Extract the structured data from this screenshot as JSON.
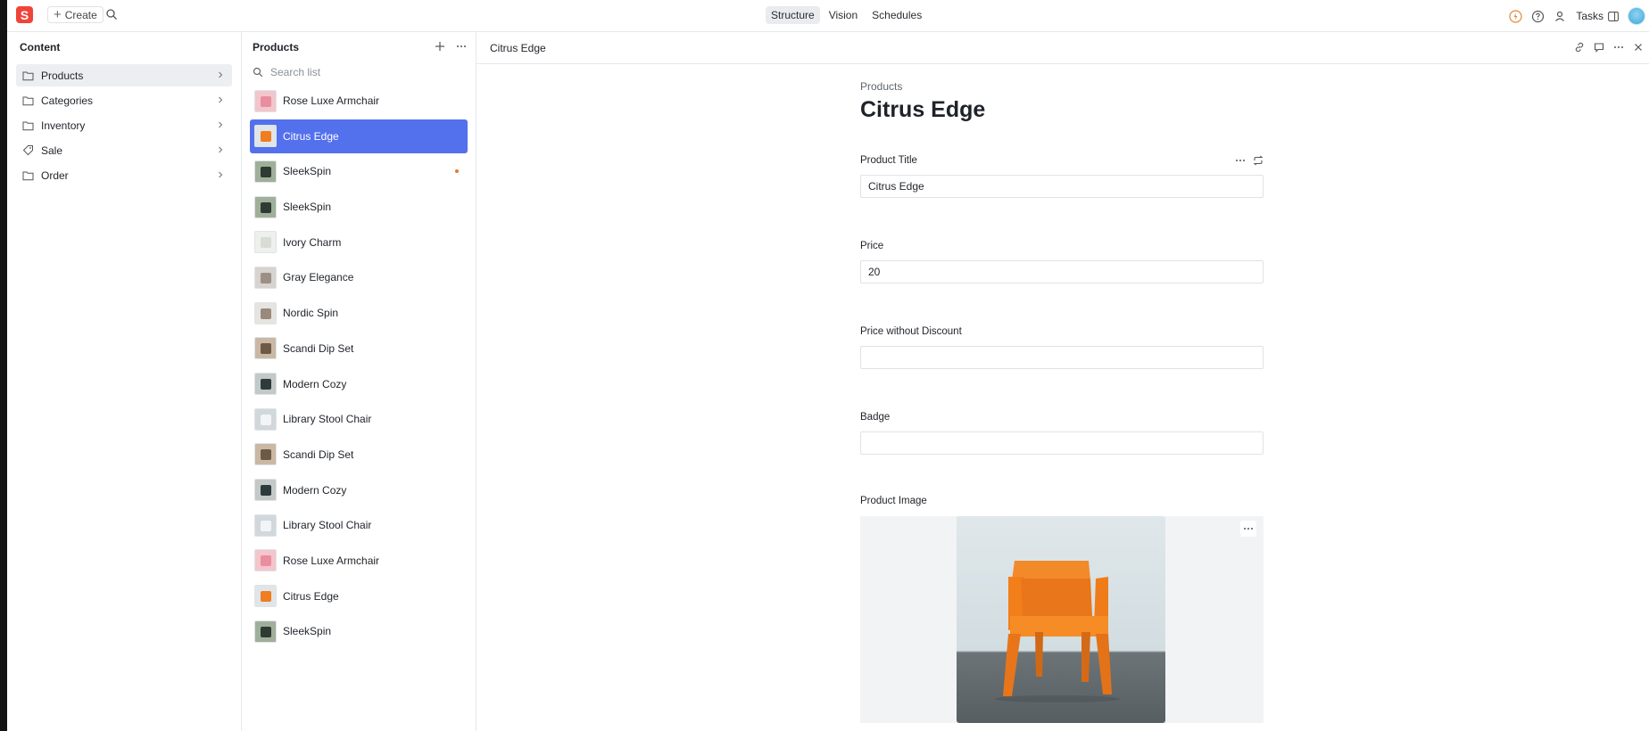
{
  "topbar": {
    "logo_letter": "S",
    "create_label": "Create",
    "tabs": [
      {
        "label": "Structure",
        "active": true
      },
      {
        "label": "Vision",
        "active": false
      },
      {
        "label": "Schedules",
        "active": false
      }
    ],
    "tasks_label": "Tasks"
  },
  "content_pane": {
    "title": "Content",
    "items": [
      {
        "label": "Products",
        "icon": "folder-icon",
        "active": true
      },
      {
        "label": "Categories",
        "icon": "folder-icon",
        "active": false
      },
      {
        "label": "Inventory",
        "icon": "folder-icon",
        "active": false
      },
      {
        "label": "Sale",
        "icon": "tag-icon",
        "active": false
      },
      {
        "label": "Order",
        "icon": "folder-icon",
        "active": false
      }
    ]
  },
  "products_pane": {
    "title": "Products",
    "search_placeholder": "Search list",
    "items": [
      {
        "label": "Rose Luxe Armchair",
        "thumb": "#f3c5cc",
        "chair": "#e98ea0"
      },
      {
        "label": "Citrus Edge",
        "thumb": "#dfe5e8",
        "chair": "#f07d1f",
        "selected": true
      },
      {
        "label": "SleekSpin",
        "thumb": "#9fb09a",
        "chair": "#2f3a33",
        "dot": true
      },
      {
        "label": "SleekSpin",
        "thumb": "#9fb09a",
        "chair": "#2f3a33"
      },
      {
        "label": "Ivory Charm",
        "thumb": "#eef0ee",
        "chair": "#d9dcd4"
      },
      {
        "label": "Gray Elegance",
        "thumb": "#d7d3cf",
        "chair": "#9b8f88"
      },
      {
        "label": "Nordic Spin",
        "thumb": "#e6e4e1",
        "chair": "#9a8a7b"
      },
      {
        "label": "Scandi Dip Set",
        "thumb": "#c9b9a4",
        "chair": "#6e5946"
      },
      {
        "label": "Modern Cozy",
        "thumb": "#c3c9c6",
        "chair": "#2e3b3c"
      },
      {
        "label": "Library Stool Chair",
        "thumb": "#d0d8dc",
        "chair": "#f2f4f5"
      },
      {
        "label": "Scandi Dip Set",
        "thumb": "#c9b9a4",
        "chair": "#6e5946"
      },
      {
        "label": "Modern Cozy",
        "thumb": "#c3c9c6",
        "chair": "#2e3b3c"
      },
      {
        "label": "Library Stool Chair",
        "thumb": "#d0d8dc",
        "chair": "#f2f4f5"
      },
      {
        "label": "Rose Luxe Armchair",
        "thumb": "#f3c5cc",
        "chair": "#e98ea0"
      },
      {
        "label": "Citrus Edge",
        "thumb": "#dfe5e8",
        "chair": "#f07d1f"
      },
      {
        "label": "SleekSpin",
        "thumb": "#9fb09a",
        "chair": "#2f3a33"
      }
    ]
  },
  "document": {
    "header_title": "Citrus Edge",
    "breadcrumb": "Products",
    "title": "Citrus Edge",
    "fields": {
      "product_title": {
        "label": "Product Title",
        "value": "Citrus Edge"
      },
      "price": {
        "label": "Price",
        "value": "20"
      },
      "price_without_discount": {
        "label": "Price without Discount",
        "value": ""
      },
      "badge": {
        "label": "Badge",
        "value": ""
      },
      "product_image": {
        "label": "Product Image"
      }
    }
  },
  "colors": {
    "accent": "#5370ed",
    "logo": "#f04438",
    "unpublished_dot": "#e7782f",
    "chair_orange": "#f07d1f"
  }
}
